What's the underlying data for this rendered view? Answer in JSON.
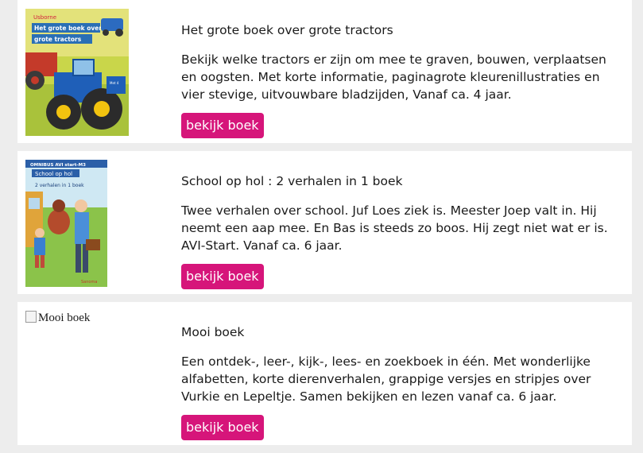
{
  "books": [
    {
      "title": "Het grote boek over grote tractors",
      "description": "Bekijk welke tractors er zijn om mee te graven, bouwen, verplaatsen en oogsten. Met korte informatie, paginagrote kleurenillustraties en vier stevige, uitvouwbare bladzijden, Vanaf ca. 4 jaar.",
      "button_label": "bekijk boek",
      "cover": {
        "publisher": "Usborne",
        "line1": "Het grote boek over",
        "line2": "grote tractors"
      }
    },
    {
      "title": "School op hol : 2 verhalen in 1 boek",
      "description": "Twee verhalen over school. Juf Loes ziek is. Meester Joep valt in. Hij neemt een aap mee. En Bas is steeds zo boos. Hij zegt niet wat er is. AVI-Start. Vanaf ca. 6 jaar.",
      "button_label": "bekijk boek",
      "cover": {
        "banner": "OMNIBUS AVI start-M3",
        "line1": "School op hol",
        "line2": "2 verhalen in 1 boek"
      }
    },
    {
      "title": "Mooi boek",
      "description": "Een ontdek-, leer-, kijk-, lees- en zoekboek in één. Met wonderlijke alfabetten, korte dierenverhalen, grappige versjes en stripjes over Vurkie en Lepeltje. Samen bekijken en lezen vanaf ca. 6 jaar.",
      "button_label": "bekijk boek",
      "cover_alt": "Mooi boek"
    }
  ],
  "colors": {
    "button": "#d6157a",
    "page_bg": "#ededed",
    "card_bg": "#ffffff"
  }
}
